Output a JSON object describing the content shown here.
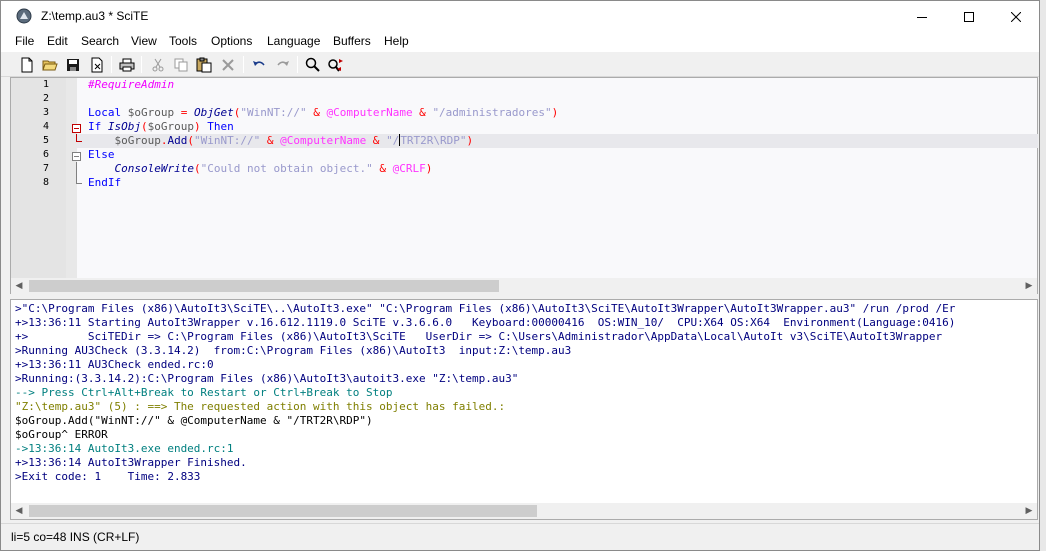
{
  "window": {
    "title": "Z:\\temp.au3 * SciTE",
    "minimize_glyph": "minimize-icon",
    "maximize_glyph": "maximize-icon",
    "close_glyph": "close-icon"
  },
  "menu": [
    "File",
    "Edit",
    "Search",
    "View",
    "Tools",
    "Options",
    "Language",
    "Buffers",
    "Help"
  ],
  "toolbar": [
    "new-file-icon",
    "open-file-icon",
    "save-icon",
    "close-file-icon",
    "print-icon",
    "cut-icon",
    "copy-icon",
    "paste-icon",
    "delete-icon",
    "undo-icon",
    "redo-icon",
    "find-icon",
    "replace-icon"
  ],
  "editor": {
    "line_numbers": [
      "1",
      "2",
      "3",
      "4",
      "5",
      "6",
      "7",
      "8"
    ],
    "current_line": 5,
    "lines": [
      [
        {
          "t": "#RequireAdmin",
          "c": "c-comment"
        }
      ],
      [],
      [
        {
          "t": "Local ",
          "c": "c-keyword"
        },
        {
          "t": "$oGroup",
          "c": "c-var"
        },
        {
          "t": " = ",
          "c": "c-op"
        },
        {
          "t": "ObjGet",
          "c": "c-func"
        },
        {
          "t": "(",
          "c": "c-op"
        },
        {
          "t": "\"WinNT://\"",
          "c": "c-str"
        },
        {
          "t": " & ",
          "c": "c-op"
        },
        {
          "t": "@ComputerName",
          "c": "c-macro"
        },
        {
          "t": " & ",
          "c": "c-op"
        },
        {
          "t": "\"/administradores\"",
          "c": "c-str"
        },
        {
          "t": ")",
          "c": "c-op"
        }
      ],
      [
        {
          "t": "If ",
          "c": "c-keyword"
        },
        {
          "t": "IsObj",
          "c": "c-func"
        },
        {
          "t": "(",
          "c": "c-op"
        },
        {
          "t": "$oGroup",
          "c": "c-var"
        },
        {
          "t": ") ",
          "c": "c-op"
        },
        {
          "t": "Then",
          "c": "c-keyword"
        }
      ],
      [
        {
          "t": "    ",
          "c": "c-plain"
        },
        {
          "t": "$oGroup",
          "c": "c-var"
        },
        {
          "t": ".",
          "c": "c-op"
        },
        {
          "t": "Add",
          "c": "c-method"
        },
        {
          "t": "(",
          "c": "c-op"
        },
        {
          "t": "\"WinNT://\"",
          "c": "c-str"
        },
        {
          "t": " & ",
          "c": "c-op"
        },
        {
          "t": "@ComputerName",
          "c": "c-macro"
        },
        {
          "t": " & ",
          "c": "c-op"
        },
        {
          "t": "\"/",
          "c": "c-str"
        },
        {
          "t": "|",
          "c": "caret"
        },
        {
          "t": "TRT2R\\RDP\"",
          "c": "c-str"
        },
        {
          "t": ")",
          "c": "c-op"
        }
      ],
      [
        {
          "t": "Else",
          "c": "c-keyword"
        }
      ],
      [
        {
          "t": "    ",
          "c": "c-plain"
        },
        {
          "t": "ConsoleWrite",
          "c": "c-func"
        },
        {
          "t": "(",
          "c": "c-op"
        },
        {
          "t": "\"Could not obtain object.\"",
          "c": "c-str"
        },
        {
          "t": " & ",
          "c": "c-op"
        },
        {
          "t": "@CRLF",
          "c": "c-macro"
        },
        {
          "t": ")",
          "c": "c-op"
        }
      ],
      [
        {
          "t": "EndIf",
          "c": "c-keyword"
        }
      ]
    ]
  },
  "output": [
    {
      "t": ">\"C:\\Program Files (x86)\\AutoIt3\\SciTE\\..\\AutoIt3.exe\" \"C:\\Program Files (x86)\\AutoIt3\\SciTE\\AutoIt3Wrapper\\AutoIt3Wrapper.au3\" /run /prod /Er",
      "c": "o-blue"
    },
    {
      "t": "+>13:36:11 Starting AutoIt3Wrapper v.16.612.1119.0 SciTE v.3.6.6.0   Keyboard:00000416  OS:WIN_10/  CPU:X64 OS:X64  Environment(Language:0416)",
      "c": "o-navy"
    },
    {
      "t": "+>         SciTEDir => C:\\Program Files (x86)\\AutoIt3\\SciTE   UserDir => C:\\Users\\Administrador\\AppData\\Local\\AutoIt v3\\SciTE\\AutoIt3Wrapper",
      "c": "o-navy"
    },
    {
      "t": ">Running AU3Check (3.3.14.2)  from:C:\\Program Files (x86)\\AutoIt3  input:Z:\\temp.au3",
      "c": "o-blue"
    },
    {
      "t": "+>13:36:11 AU3Check ended.rc:0",
      "c": "o-navy"
    },
    {
      "t": ">Running:(3.3.14.2):C:\\Program Files (x86)\\AutoIt3\\autoit3.exe \"Z:\\temp.au3\"",
      "c": "o-blue"
    },
    {
      "t": "--> Press Ctrl+Alt+Break to Restart or Ctrl+Break to Stop",
      "c": "o-teal"
    },
    {
      "t": "\"Z:\\temp.au3\" (5) : ==> The requested action with this object has failed.:",
      "c": "o-olive"
    },
    {
      "t": "$oGroup.Add(\"WinNT://\" & @ComputerName & \"/TRT2R\\RDP\")",
      "c": "o-plain"
    },
    {
      "t": "$oGroup^ ERROR",
      "c": "o-plain"
    },
    {
      "t": "->13:36:14 AutoIt3.exe ended.rc:1",
      "c": "o-teal"
    },
    {
      "t": "+>13:36:14 AutoIt3Wrapper Finished.",
      "c": "o-navy"
    },
    {
      "t": ">Exit code: 1    Time: 2.833",
      "c": "o-blue"
    }
  ],
  "status": {
    "text": "li=5 co=48 INS (CR+LF)"
  }
}
